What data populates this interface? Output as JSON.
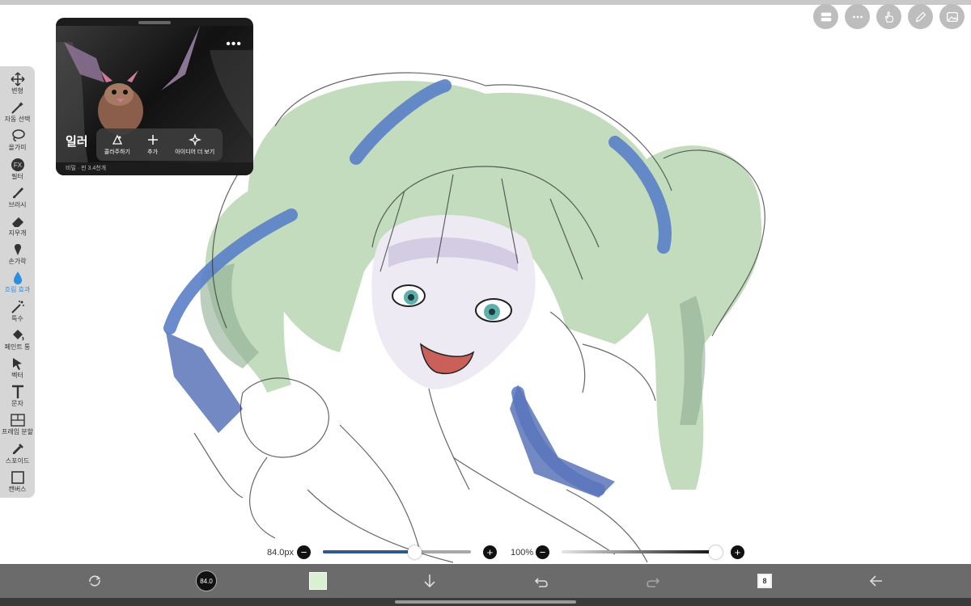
{
  "top_right": {
    "buttons": [
      {
        "icon": "controls-icon"
      },
      {
        "icon": "more-icon"
      },
      {
        "icon": "hand-icon"
      },
      {
        "icon": "pencil-icon"
      },
      {
        "icon": "gallery-icon"
      }
    ]
  },
  "toolbar": {
    "tools": [
      {
        "label": "변형",
        "icon": "move-icon",
        "active": false
      },
      {
        "label": "자동 선택",
        "icon": "magic-wand-icon",
        "active": false
      },
      {
        "label": "올가미",
        "icon": "lasso-icon",
        "active": false
      },
      {
        "label": "필터",
        "icon": "fx-icon",
        "active": false
      },
      {
        "label": "브러시",
        "icon": "brush-icon",
        "active": false
      },
      {
        "label": "지우개",
        "icon": "eraser-icon",
        "active": false
      },
      {
        "label": "손가락",
        "icon": "smudge-icon",
        "active": false
      },
      {
        "label": "흐림 효과",
        "icon": "blur-drop-icon",
        "active": true
      },
      {
        "label": "특수",
        "icon": "sparkle-wand-icon",
        "active": false
      },
      {
        "label": "페인트 통",
        "icon": "bucket-icon",
        "active": false
      },
      {
        "label": "벡터",
        "icon": "cursor-icon",
        "active": false
      },
      {
        "label": "문자",
        "icon": "text-icon",
        "active": false
      },
      {
        "label": "프레임 분할",
        "icon": "frame-icon",
        "active": false
      },
      {
        "label": "스포이드",
        "icon": "eyedropper-icon",
        "active": false
      },
      {
        "label": "캔버스",
        "icon": "canvas-icon",
        "active": false
      }
    ]
  },
  "reference_popup": {
    "title": "일러",
    "more_label": "•••",
    "footer": "비밀 · 핀 3.4천개",
    "actions": [
      {
        "label": "콜라주하기",
        "icon": "collage-icon"
      },
      {
        "label": "추가",
        "icon": "plus-icon"
      },
      {
        "label": "아이디어 더 보기",
        "icon": "sparkles-icon"
      }
    ]
  },
  "sliders": {
    "size_value": "84.0px",
    "size_fraction": 0.62,
    "opacity_value": "100%",
    "opacity_fraction": 1.0,
    "minus": "−",
    "plus": "+"
  },
  "bottom_bar": {
    "brush_size_label": "84.0",
    "layer_count": "8",
    "color": "#d9f0d2"
  }
}
